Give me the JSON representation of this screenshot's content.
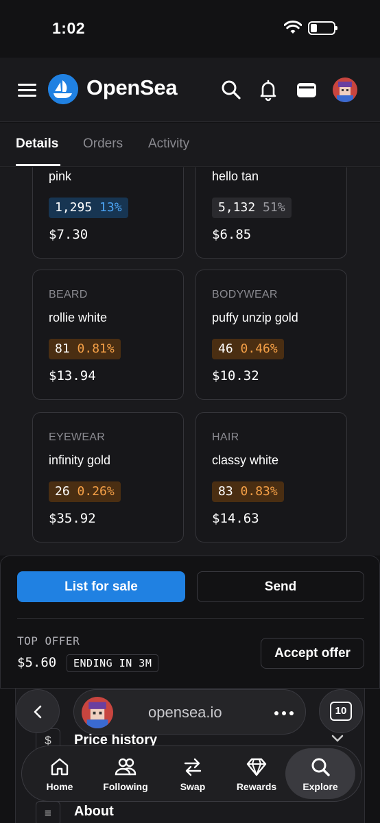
{
  "status": {
    "time": "1:02"
  },
  "header": {
    "brand": "OpenSea"
  },
  "tabs": [
    {
      "label": "Details",
      "active": true
    },
    {
      "label": "Orders",
      "active": false
    },
    {
      "label": "Activity",
      "active": false
    }
  ],
  "traits": [
    {
      "type": "",
      "value": "pink",
      "count": "1,295",
      "percent": "13%",
      "style": "blue",
      "price": "$7.30"
    },
    {
      "type": "",
      "value": "hello tan",
      "count": "5,132",
      "percent": "51%",
      "style": "grey",
      "price": "$6.85"
    },
    {
      "type": "BEARD",
      "value": "rollie white",
      "count": "81",
      "percent": "0.81%",
      "style": "rare",
      "price": "$13.94"
    },
    {
      "type": "BODYWEAR",
      "value": "puffy unzip gold",
      "count": "46",
      "percent": "0.46%",
      "style": "rare",
      "price": "$10.32"
    },
    {
      "type": "EYEWEAR",
      "value": "infinity gold",
      "count": "26",
      "percent": "0.26%",
      "style": "rare",
      "price": "$35.92"
    },
    {
      "type": "HAIR",
      "value": "classy white",
      "count": "83",
      "percent": "0.83%",
      "style": "rare",
      "price": "$14.63"
    }
  ],
  "actions": {
    "list_label": "List for sale",
    "send_label": "Send",
    "top_offer_label": "TOP OFFER",
    "top_offer_price": "$5.60",
    "ending": "ENDING IN 3M",
    "accept_label": "Accept offer"
  },
  "sections": {
    "price_history": "Price history",
    "price_history_icon": "$",
    "about": "About",
    "about_icon": "≡"
  },
  "browser": {
    "url": "opensea.io",
    "tab_count": "10"
  },
  "nav": [
    {
      "label": "Home",
      "icon": "home-icon"
    },
    {
      "label": "Following",
      "icon": "people-icon"
    },
    {
      "label": "Swap",
      "icon": "swap-icon"
    },
    {
      "label": "Rewards",
      "icon": "diamond-icon"
    },
    {
      "label": "Explore",
      "icon": "search-icon",
      "active": true
    }
  ],
  "colors": {
    "accent": "#2081e2",
    "rare_bg": "#4a2e12",
    "rare_text": "#f5a047",
    "background": "#121214"
  }
}
